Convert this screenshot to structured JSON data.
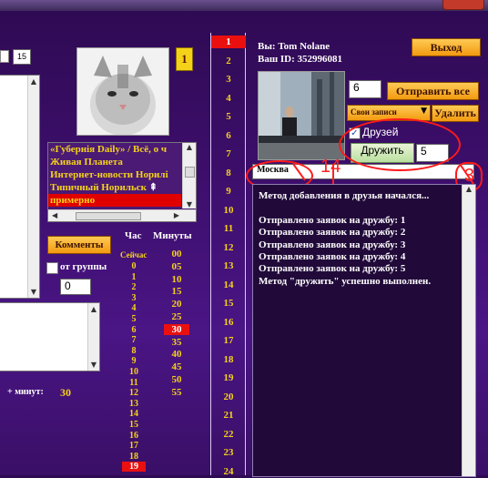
{
  "calendar_icon": {
    "day": "15"
  },
  "badge_left": "1",
  "group_list": {
    "items": [
      {
        "label": "«Губернiя Daily» / Всё, о ч",
        "color": "#f5d21a",
        "bg": ""
      },
      {
        "label": "Живая Планета",
        "color": "#f5d21a",
        "bg": ""
      },
      {
        "label": "Интернет-новости Норилі",
        "color": "#f5d21a",
        "bg": ""
      },
      {
        "label": "Типичный Норильск",
        "color": "#f5d21a",
        "bg": ""
      },
      {
        "label": "примерно",
        "color": "#f5d21a",
        "bg": "#e00000"
      }
    ]
  },
  "comments_button": "Комменты",
  "from_group": {
    "label": "от группы",
    "value": "0"
  },
  "schedule": {
    "hour_header": "Час",
    "minutes_header": "Минуты",
    "now_label": "Сейчас",
    "hours": [
      "0",
      "1",
      "2",
      "3",
      "4",
      "5",
      "6",
      "7",
      "8",
      "9",
      "10",
      "11",
      "12",
      "13",
      "14",
      "15",
      "16",
      "17",
      "18",
      "19"
    ],
    "minutes": [
      "00",
      "05",
      "10",
      "15",
      "20",
      "25",
      "30",
      "35",
      "40",
      "45",
      "50",
      "55"
    ],
    "selected_minute": "30",
    "selected_hour": "19",
    "plus_minutes_label": "+ минут:",
    "plus_minutes_value": "30"
  },
  "numbers": [
    "1",
    "2",
    "3",
    "4",
    "5",
    "6",
    "7",
    "8",
    "9",
    "10",
    "11",
    "12",
    "13",
    "14",
    "15",
    "16",
    "17",
    "18",
    "19",
    "20",
    "21",
    "22",
    "23",
    "24"
  ],
  "selected_number": "1",
  "user": {
    "you_label": "Вы: Tom Nolane",
    "id_label": "Ваш ID: 352996081"
  },
  "exit_button": "Выход",
  "send_count": "6",
  "send_all_button": "Отправить все",
  "posts_select": "Свои записи",
  "delete_button": "Удалить",
  "friends_checkbox": {
    "label": "Друзей",
    "checked": true
  },
  "befriend_button": "Дружить",
  "befriend_count": "5",
  "city_input": "Москва",
  "annotations": {
    "left": "14",
    "right": "3"
  },
  "log": [
    "Метод добавления в друзья начался...",
    "",
    "Отправлено заявок на дружбу: 1",
    "Отправлено заявок на дружбу: 2",
    "Отправлено заявок на дружбу: 3",
    "Отправлено заявок на дружбу: 4",
    "Отправлено заявок на дружбу: 5",
    "Метод \"дружить\" успешно выполнен."
  ],
  "colors": {
    "accent_yellow": "#f5d21a",
    "highlight_red": "#ea1010",
    "button_orange": "#f39a10",
    "bg_purple": "#3c0e6a"
  }
}
